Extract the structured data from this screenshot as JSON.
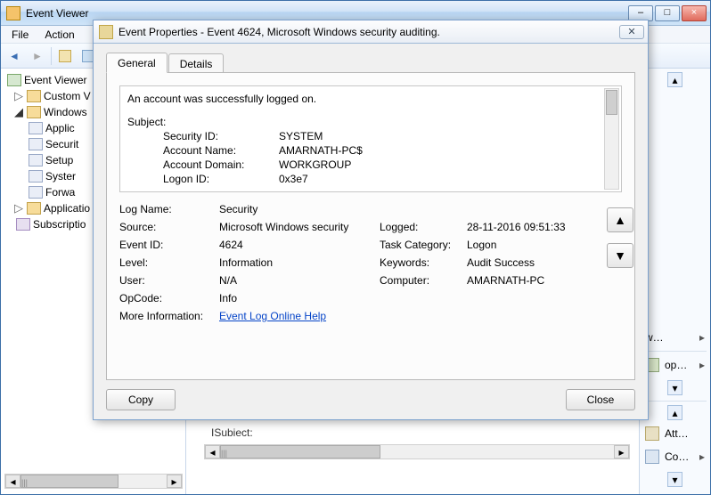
{
  "main_window": {
    "title": "Event Viewer",
    "menu": {
      "file": "File",
      "action": "Action"
    },
    "win_min": "–",
    "win_max": "□",
    "win_close": "×"
  },
  "tree": {
    "root": "Event Viewer",
    "custom": "Custom V",
    "windows": "Windows",
    "applic": "Applic",
    "security": "Securit",
    "setup": "Setup",
    "system": "Syster",
    "forward": "Forwa",
    "applications": "Applicatio",
    "subscriptions": "Subscriptio"
  },
  "dialog": {
    "title": "Event Properties - Event 4624, Microsoft Windows security auditing.",
    "tab_general": "General",
    "tab_details": "Details",
    "desc_line": "An account was successfully logged on.",
    "subject_label": "Subject:",
    "subject": {
      "sid_l": "Security ID:",
      "sid_v": "SYSTEM",
      "acct_l": "Account Name:",
      "acct_v": "AMARNATH-PC$",
      "dom_l": "Account Domain:",
      "dom_v": "WORKGROUP",
      "lid_l": "Logon ID:",
      "lid_v": "0x3e7"
    },
    "props": {
      "log_l": "Log Name:",
      "log_v": "Security",
      "src_l": "Source:",
      "src_v": "Microsoft Windows security",
      "eid_l": "Event ID:",
      "eid_v": "4624",
      "lvl_l": "Level:",
      "lvl_v": "Information",
      "usr_l": "User:",
      "usr_v": "N/A",
      "opc_l": "OpCode:",
      "opc_v": "Info",
      "more_l": "More Information:",
      "more_link": "Event Log Online Help",
      "logged_l": "Logged:",
      "logged_v": "28-11-2016 09:51:33",
      "task_l": "Task Category:",
      "task_v": "Logon",
      "kw_l": "Keywords:",
      "kw_v": "Audit Success",
      "comp_l": "Computer:",
      "comp_v": "AMARNATH-PC"
    },
    "copy": "Copy",
    "close": "Close",
    "up": "▲",
    "down": "▼"
  },
  "actpane": {
    "w": "w…",
    "op": "op…",
    "att": "Att…",
    "co": "Co…"
  },
  "bottom_subject": "ISubiect:",
  "glyph": {
    "tri_closed": "▷",
    "tri_open": "◢",
    "back": "◄",
    "fwd": "►",
    "chev": "▸",
    "thumb": "|||"
  }
}
